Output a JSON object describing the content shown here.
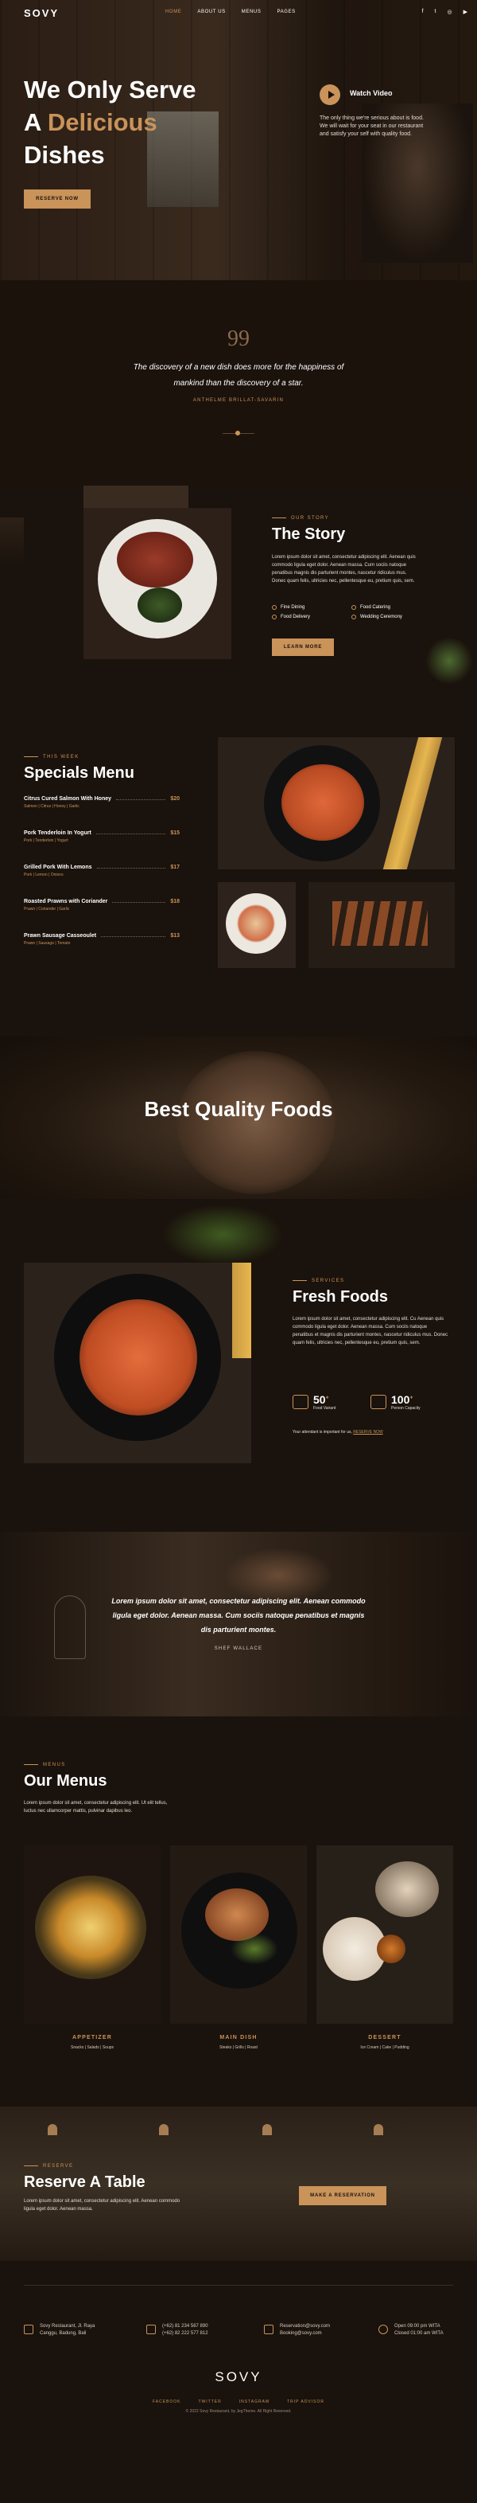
{
  "brand": "SOVY",
  "nav": {
    "items": [
      "HOME",
      "ABOUT US",
      "MENUS",
      "PAGES"
    ],
    "social": [
      "f",
      "t",
      "ig",
      "yt"
    ]
  },
  "hero": {
    "line1": "We Only Serve",
    "line2a": "A ",
    "line2b": "Delicious",
    "line3": "Dishes",
    "button": "RESERVE NOW",
    "video_label": "Watch Video",
    "video_text": "The only thing we're serious about is food. We will wait for your seat in our restaurant and satisfy your self with quality food."
  },
  "quote": {
    "mark": "99",
    "text": "The discovery of a new dish does more for the happiness of mankind than the discovery of a star.",
    "author": "ANTHELME BRILLAT-SAVARIN"
  },
  "story": {
    "label": "OUR STORY",
    "title": "The Story",
    "body": "Lorem ipsum dolor sit amet, consectetur adipiscing elit. Aenean quis commodo ligula eget dolor. Aenean massa. Cum sociis natoque penatibus magnis dis parturient montes, nascetur ridiculus mus. Donec quam felis, ultricies nec, pellentesque eu, pretium quis, sem.",
    "features": [
      "Fine Dining",
      "Food Catering",
      "Food Delivery",
      "Wedding Ceremony"
    ],
    "button": "LEARN MORE"
  },
  "specials": {
    "label": "THIS WEEK",
    "title": "Specials Menu",
    "items": [
      {
        "name": "Citrus Cured Salmon With Honey",
        "price": "$20",
        "ing": "Salmon | Citrus | Honey | Garlic"
      },
      {
        "name": "Pork Tenderloin In Yogurt",
        "price": "$15",
        "ing": "Pork | Tenderloin | Yogurt"
      },
      {
        "name": "Grilled Pork With Lemons",
        "price": "$17",
        "ing": "Pork | Lemon | Onions"
      },
      {
        "name": "Roasted Prawns with Coriander",
        "price": "$18",
        "ing": "Prawn | Coriander | Garlic"
      },
      {
        "name": "Prawn Sausage Casseoulet",
        "price": "$13",
        "ing": "Prawn | Sausage | Tomato"
      }
    ]
  },
  "best": {
    "title": "Best Quality Foods"
  },
  "fresh": {
    "label": "SERVICES",
    "title": "Fresh Foods",
    "body": "Lorem ipsum dolor sit amet, consectetur adipiscing elit. Cu Aenean quis commodo ligula eget dolor. Aenean massa. Cum sociis natoque penatibus et magnis dis parturient montes, nascetur ridiculus mus. Donec quam felis, ultricies nec, pellentesque eu, pretium quis, sem.",
    "stat1": {
      "num": "50",
      "sup": "+",
      "text": "Food Variant"
    },
    "stat2": {
      "num": "100",
      "sup": "+",
      "text": "Person Capacity"
    },
    "note": "Your attendant is important for us,",
    "note_link": "RESERVE NOW"
  },
  "testimonial": {
    "text": "Lorem ipsum dolor sit amet, consectetur adipiscing elit. Aenean commodo ligula eget dolor. Aenean massa. Cum sociis natoque penatibus et magnis dis parturient montes.",
    "author": "SHEF WALLACE"
  },
  "menus": {
    "label": "MENUS",
    "title": "Our Menus",
    "body": "Lorem ipsum dolor sit amet, consectetur adipiscing elit. Ut elit tellus, luctus nec ullamcorper mattis, pulvinar dapibus leo.",
    "cards": [
      {
        "title": "APPETIZER",
        "sub": "Snacks | Salads | Soups"
      },
      {
        "title": "MAIN DISH",
        "sub": "Steaks | Grills | Roast"
      },
      {
        "title": "DESSERT",
        "sub": "Ice Cream | Cake | Pudding"
      }
    ]
  },
  "reserve": {
    "label": "RESERVE",
    "title": "Reserve A Table",
    "body": "Lorem ipsum dolor sit amet, consectetur adipiscing elit. Aenean commodo ligula eget dolor. Aenean massa.",
    "button": "MAKE A RESERVATION"
  },
  "footer": {
    "address1": "Sovy Restaurant, Jl. Raya",
    "address2": "Canggu, Badung, Bali",
    "phone1": "(+62) 81 234 567 890",
    "phone2": "(+62) 82 222 577 812",
    "email1": "Reservation@sovy.com",
    "email2": "Booking@sovy.com",
    "hours1": "Open 09:00 pm WITA",
    "hours2": "Closed 01:00 am WITA",
    "logo": "SOVY",
    "links": [
      "FACEBOOK",
      "TWITTER",
      "INSTAGRAM",
      "TRIP ADVISOR"
    ],
    "copyright": "© 2022 Sovy Restaurant, by JegTheme. All Right Reserved."
  }
}
